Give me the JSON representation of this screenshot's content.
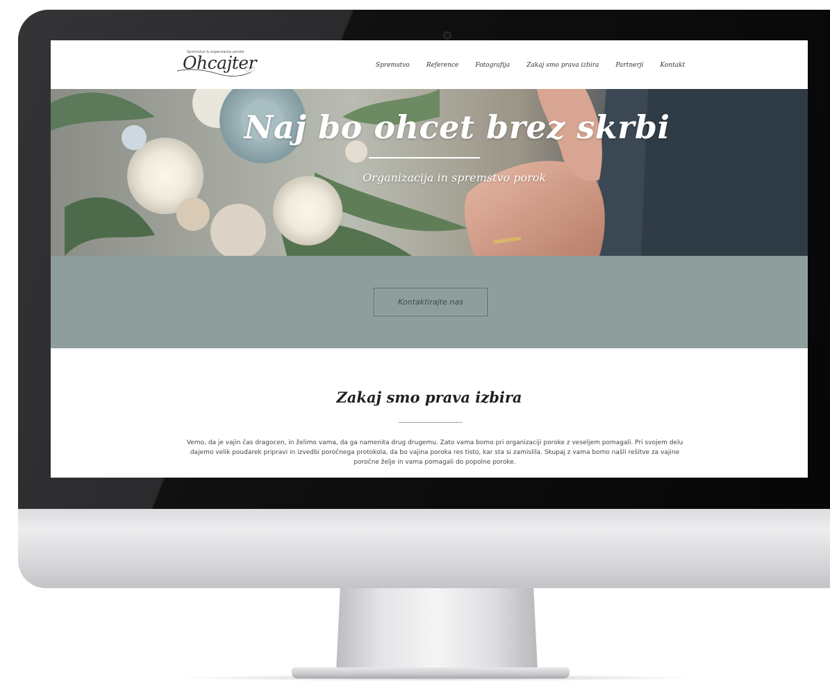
{
  "site": {
    "logo": {
      "tagline": "Spremstvo & organizacija poroke",
      "name": "Ohcajter",
      "hearts": "♡♡"
    },
    "nav": {
      "items": [
        {
          "label": "Spremstvo"
        },
        {
          "label": "Reference"
        },
        {
          "label": "Fotografija"
        },
        {
          "label": "Zakaj smo prava izbira"
        },
        {
          "label": "Partnerji"
        },
        {
          "label": "Kontakt"
        }
      ]
    },
    "hero": {
      "title": "Naj bo ohcet brez skrbi",
      "subtitle": "Organizacija in spremstvo porok"
    },
    "cta": {
      "label": "Kontaktirajte nas"
    },
    "why": {
      "title": "Zakaj smo prava izbira",
      "text": "Vemo, da je vajin čas dragocen, in želimo vama, da ga namenita drug drugemu. Zato vama bomo pri organizaciji poroke z veseljem pomagali. Pri svojem delu dajemo velik poudarek pripravi in izvedbi poročnega protokola, da bo vajina poroka res tisto, kar sta si zamislila. Skupaj z vama bomo našli rešitve za vajine poročne želje in vama pomagali do popolne poroke."
    }
  },
  "colors": {
    "cta_band": "#8d9e9d",
    "bezel": "#1d1d1f",
    "text": "#444444"
  }
}
